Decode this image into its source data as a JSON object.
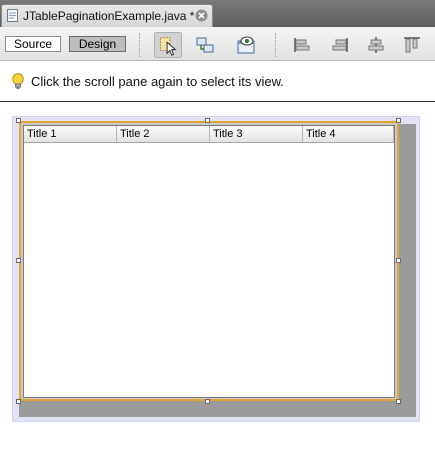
{
  "tab": {
    "title": "JTablePaginationExample.java *"
  },
  "toolbar": {
    "source_label": "Source",
    "design_label": "Design",
    "icons": [
      "selection-mode-icon",
      "connection-mode-icon",
      "preview-design-icon",
      "align-left-icon",
      "align-right-icon",
      "center-horizontally-icon",
      "align-top-icon"
    ]
  },
  "hint": {
    "text": "Click the scroll pane again to select its view."
  },
  "table": {
    "columns": [
      "Title 1",
      "Title 2",
      "Title 3",
      "Title 4"
    ]
  },
  "colors": {
    "selection_border": "#e0a635",
    "form_background": "#e1e2f4",
    "panel_gray": "#9b9b9b"
  }
}
